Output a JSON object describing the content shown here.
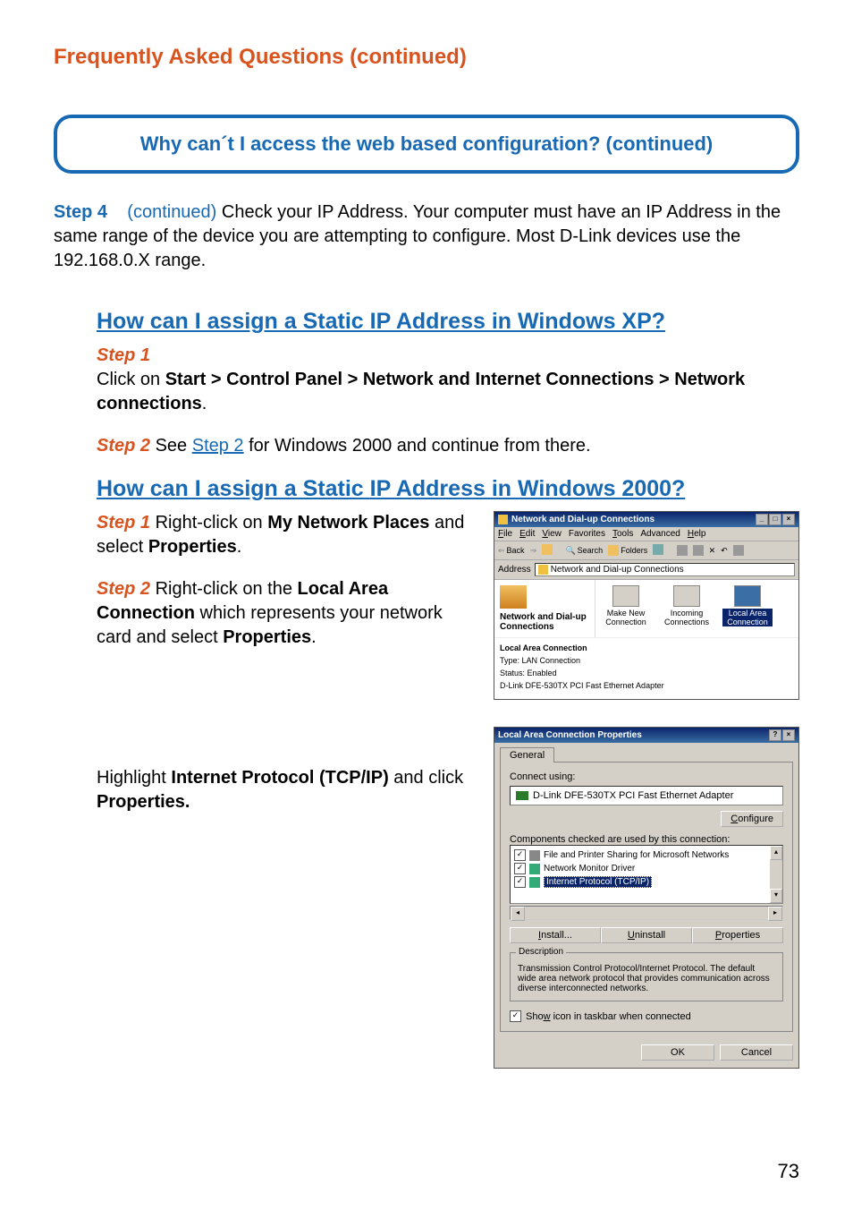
{
  "page": {
    "title": "Frequently Asked Questions (continued)",
    "pageNumber": "73"
  },
  "question": "Why can´t I access the web based configuration? (continued)",
  "step4": {
    "label": "Step 4",
    "continued": "(continued)",
    "text": "Check your IP Address. Your computer must have an IP Address in the same range of the device you are attempting to configure. Most D-Link devices use the 192.168.0.X range."
  },
  "xp": {
    "heading": "How can I assign a Static IP Address in Windows XP?",
    "step1": {
      "label": "Step 1",
      "pre": "Click on ",
      "bold": "Start > Control Panel > Network and Internet Connections > Network connections",
      "post": "."
    },
    "step2": {
      "label": "Step 2",
      "pre": " See ",
      "link": "Step 2",
      "post": " for Windows 2000 and continue from there."
    }
  },
  "w2k": {
    "heading": "How can I assign a Static IP Address in Windows 2000?",
    "step1": {
      "label": "Step 1",
      "t1": " Right-click on ",
      "b1": "My Network Places",
      "t2": " and select ",
      "b2": "Properties",
      "t3": "."
    },
    "step2": {
      "label": "Step 2",
      "t1": " Right-click on the ",
      "b1": "Local Area Connection",
      "t2": " which represents your network card and select ",
      "b2": "Properties",
      "t3": "."
    },
    "step3": {
      "t1": "Highlight ",
      "b1": "Internet Protocol (TCP/IP)",
      "t2": " and click ",
      "b2": "Properties."
    }
  },
  "shot1": {
    "title": "Network and Dial-up Connections",
    "menus": [
      "File",
      "Edit",
      "View",
      "Favorites",
      "Tools",
      "Advanced",
      "Help"
    ],
    "toolbar": {
      "back": "Back",
      "search": "Search",
      "folders": "Folders"
    },
    "addressLabel": "Address",
    "addressValue": "Network and Dial-up Connections",
    "leftTitle": "Network and Dial-up Connections",
    "icons": [
      {
        "label": "Make New Connection",
        "selected": false
      },
      {
        "label": "Incoming Connections",
        "selected": false
      },
      {
        "label": "Local Area Connection",
        "selected": true
      }
    ],
    "info": {
      "name": "Local Area Connection",
      "type": "Type: LAN Connection",
      "status": "Status: Enabled",
      "device": "D-Link DFE-530TX PCI Fast Ethernet Adapter"
    }
  },
  "shot2": {
    "title": "Local Area Connection Properties",
    "tab": "General",
    "connectUsing": "Connect using:",
    "nic": "D-Link DFE-530TX PCI Fast Ethernet Adapter",
    "configure": "Configure",
    "componentsLabel": "Components checked are used by this connection:",
    "items": [
      "File and Printer Sharing for Microsoft Networks",
      "Network Monitor Driver",
      "Internet Protocol (TCP/IP)"
    ],
    "install": "Install...",
    "uninstall": "Uninstall",
    "properties": "Properties",
    "descLegend": "Description",
    "descText": "Transmission Control Protocol/Internet Protocol. The default wide area network protocol that provides communication across diverse interconnected networks.",
    "showIcon": "Show icon in taskbar when connected",
    "ok": "OK",
    "cancel": "Cancel"
  }
}
